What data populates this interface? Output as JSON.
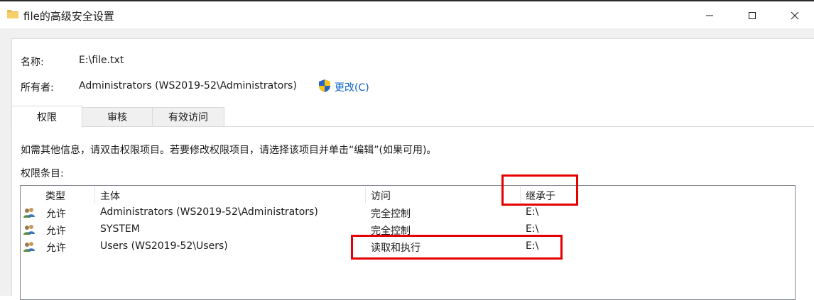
{
  "window": {
    "title": "file的高级安全设置",
    "folder_icon": "folder-icon",
    "controls": {
      "minimize": "minimize-icon",
      "maximize": "maximize-icon",
      "close": "close-icon"
    }
  },
  "info": {
    "name_label": "名称:",
    "name_value": "E:\\file.txt",
    "owner_label": "所有者:",
    "owner_value": "Administrators (WS2019-52\\Administrators)",
    "change_icon": "uac-shield-icon",
    "change_link": "更改(C)"
  },
  "tabs": [
    {
      "label": "权限",
      "active": true
    },
    {
      "label": "审核",
      "active": false
    },
    {
      "label": "有效访问",
      "active": false
    }
  ],
  "hint": "如需其他信息，请双击权限项目。若要修改权限项目，请选择该项目并单击“编辑”(如果可用)。",
  "entries_label": "权限条目:",
  "table": {
    "columns": [
      "类型",
      "主体",
      "访问",
      "继承于"
    ],
    "rows": [
      {
        "icon": "user-group-icon",
        "type": "允许",
        "principal": "Administrators (WS2019-52\\Administrators)",
        "access": "完全控制",
        "inherited": "E:\\"
      },
      {
        "icon": "user-group-icon",
        "type": "允许",
        "principal": "SYSTEM",
        "access": "完全控制",
        "inherited": "E:\\"
      },
      {
        "icon": "user-group-icon",
        "type": "允许",
        "principal": "Users (WS2019-52\\Users)",
        "access": "读取和执行",
        "inherited": "E:\\"
      }
    ]
  },
  "colors": {
    "highlight": "#e60000",
    "link": "#0b63c5",
    "dialog_bg": "#f0f0f0"
  }
}
